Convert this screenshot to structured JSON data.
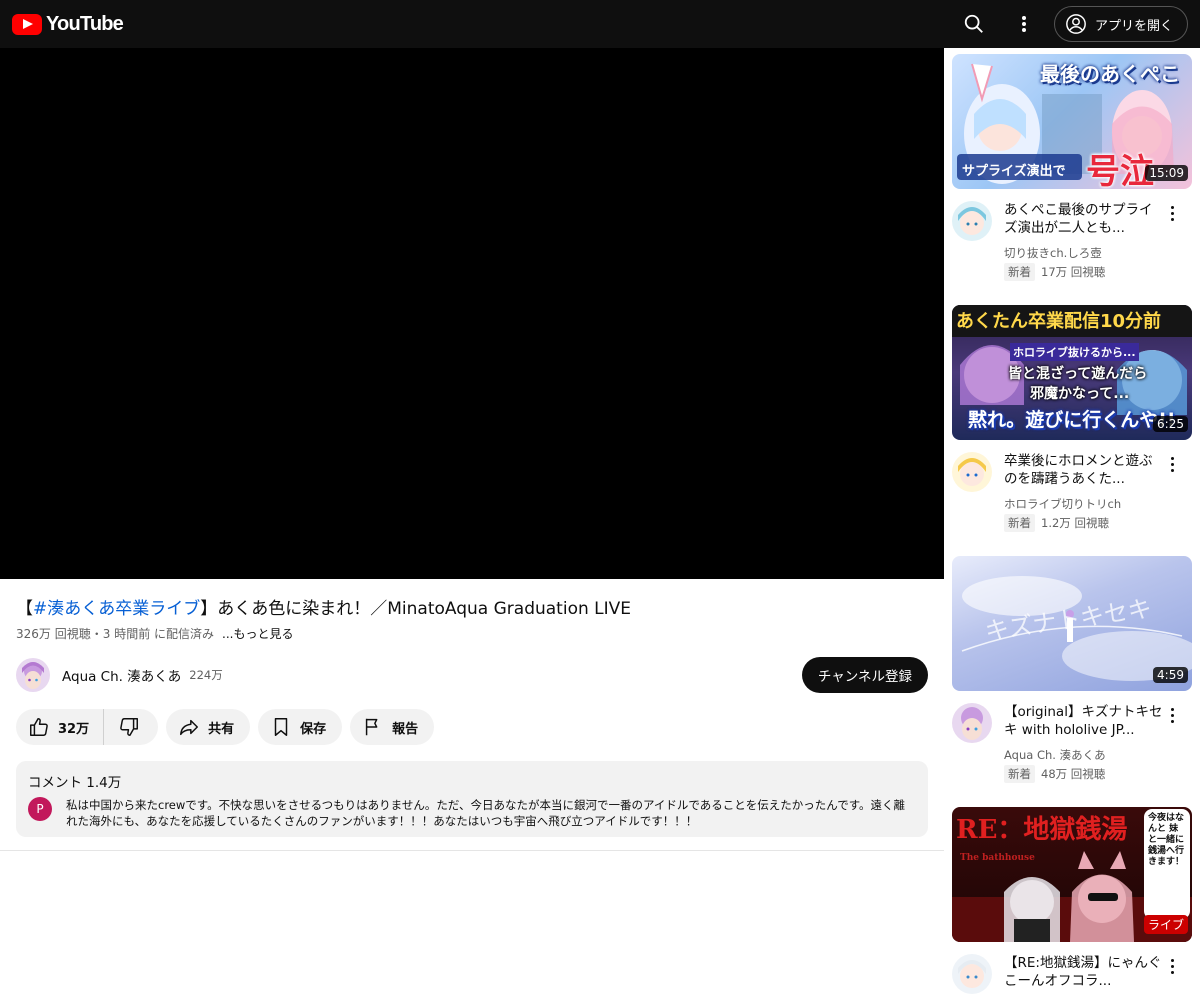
{
  "header": {
    "logo_text": "YouTube",
    "open_app_label": "アプリを開く"
  },
  "video": {
    "title_tag": "#湊あくあ卒業ライブ",
    "title_open": "【",
    "title_rest": "】あくあ色に染まれ！／MinatoAqua Graduation LIVE",
    "views": "326万 回視聴",
    "separator": "・",
    "streamed": "3 時間前 に配信済み",
    "more_label": "...もっと見る"
  },
  "channel": {
    "name": "Aqua Ch. 湊あくあ",
    "subscribers": "224万",
    "subscribe_label": "チャンネル登録"
  },
  "actions": {
    "like_count": "32万",
    "share_label": "共有",
    "save_label": "保存",
    "report_label": "報告"
  },
  "comments": {
    "header": "コメント 1.4万",
    "top_author_initial": "P",
    "top_comment": "私は中国から来たcrewです。不快な思いをさせるつもりはありません。ただ、今日あなたが本当に銀河で一番のアイドルであることを伝えたかったんです。遠く離れた海外にも、あなたを応援しているたくさんのファンがいます！！！あなたはいつも宇宙へ飛び立つアイドルです！！！"
  },
  "recommendations": [
    {
      "thumb_text_top": "最後のあくぺこ",
      "thumb_text_bottom": "サプライズ演出で",
      "thumb_text_big": "号泣",
      "duration": "15:09",
      "title": "あくぺこ最後のサプライズ演出が二人とも...",
      "channel": "切り抜きch.しろ壺",
      "badge": "新着",
      "views": "17万 回視聴"
    },
    {
      "thumb_text_top": "あくたん卒業配信10分前",
      "thumb_text_mid1": "ホロライブ抜けるから...",
      "thumb_text_mid2": "皆と混ざって遊んだら",
      "thumb_text_mid3": "邪魔かなって...",
      "thumb_text_bottom": "黙れ。遊びに行くんや!!",
      "duration": "6:25",
      "title": "卒業後にホロメンと遊ぶのを躊躇うあくた...",
      "channel": "ホロライブ切りトリch",
      "badge": "新着",
      "views": "1.2万 回視聴"
    },
    {
      "thumb_text_overlay": "キズナトキセキ",
      "duration": "4:59",
      "title": "【original】キズナトキセキ with hololive JP...",
      "channel": "Aqua Ch. 湊あくあ",
      "badge": "新着",
      "views": "48万 回視聴"
    },
    {
      "thumb_text_top": "RE：地獄銭湯",
      "thumb_text_sub": "The bathhouse",
      "thumb_text_side": "今夜はなんと 妹と一緒に 銭湯へ行きます！",
      "duration": "ライブ",
      "title": "【RE:地獄銭湯】にゃんぐこーんオフコラ..."
    }
  ],
  "colors": {
    "brand_red": "#ff0000",
    "link_blue": "#065fd4",
    "live_red": "#cc0000",
    "topbar": "#0f0f0f"
  }
}
